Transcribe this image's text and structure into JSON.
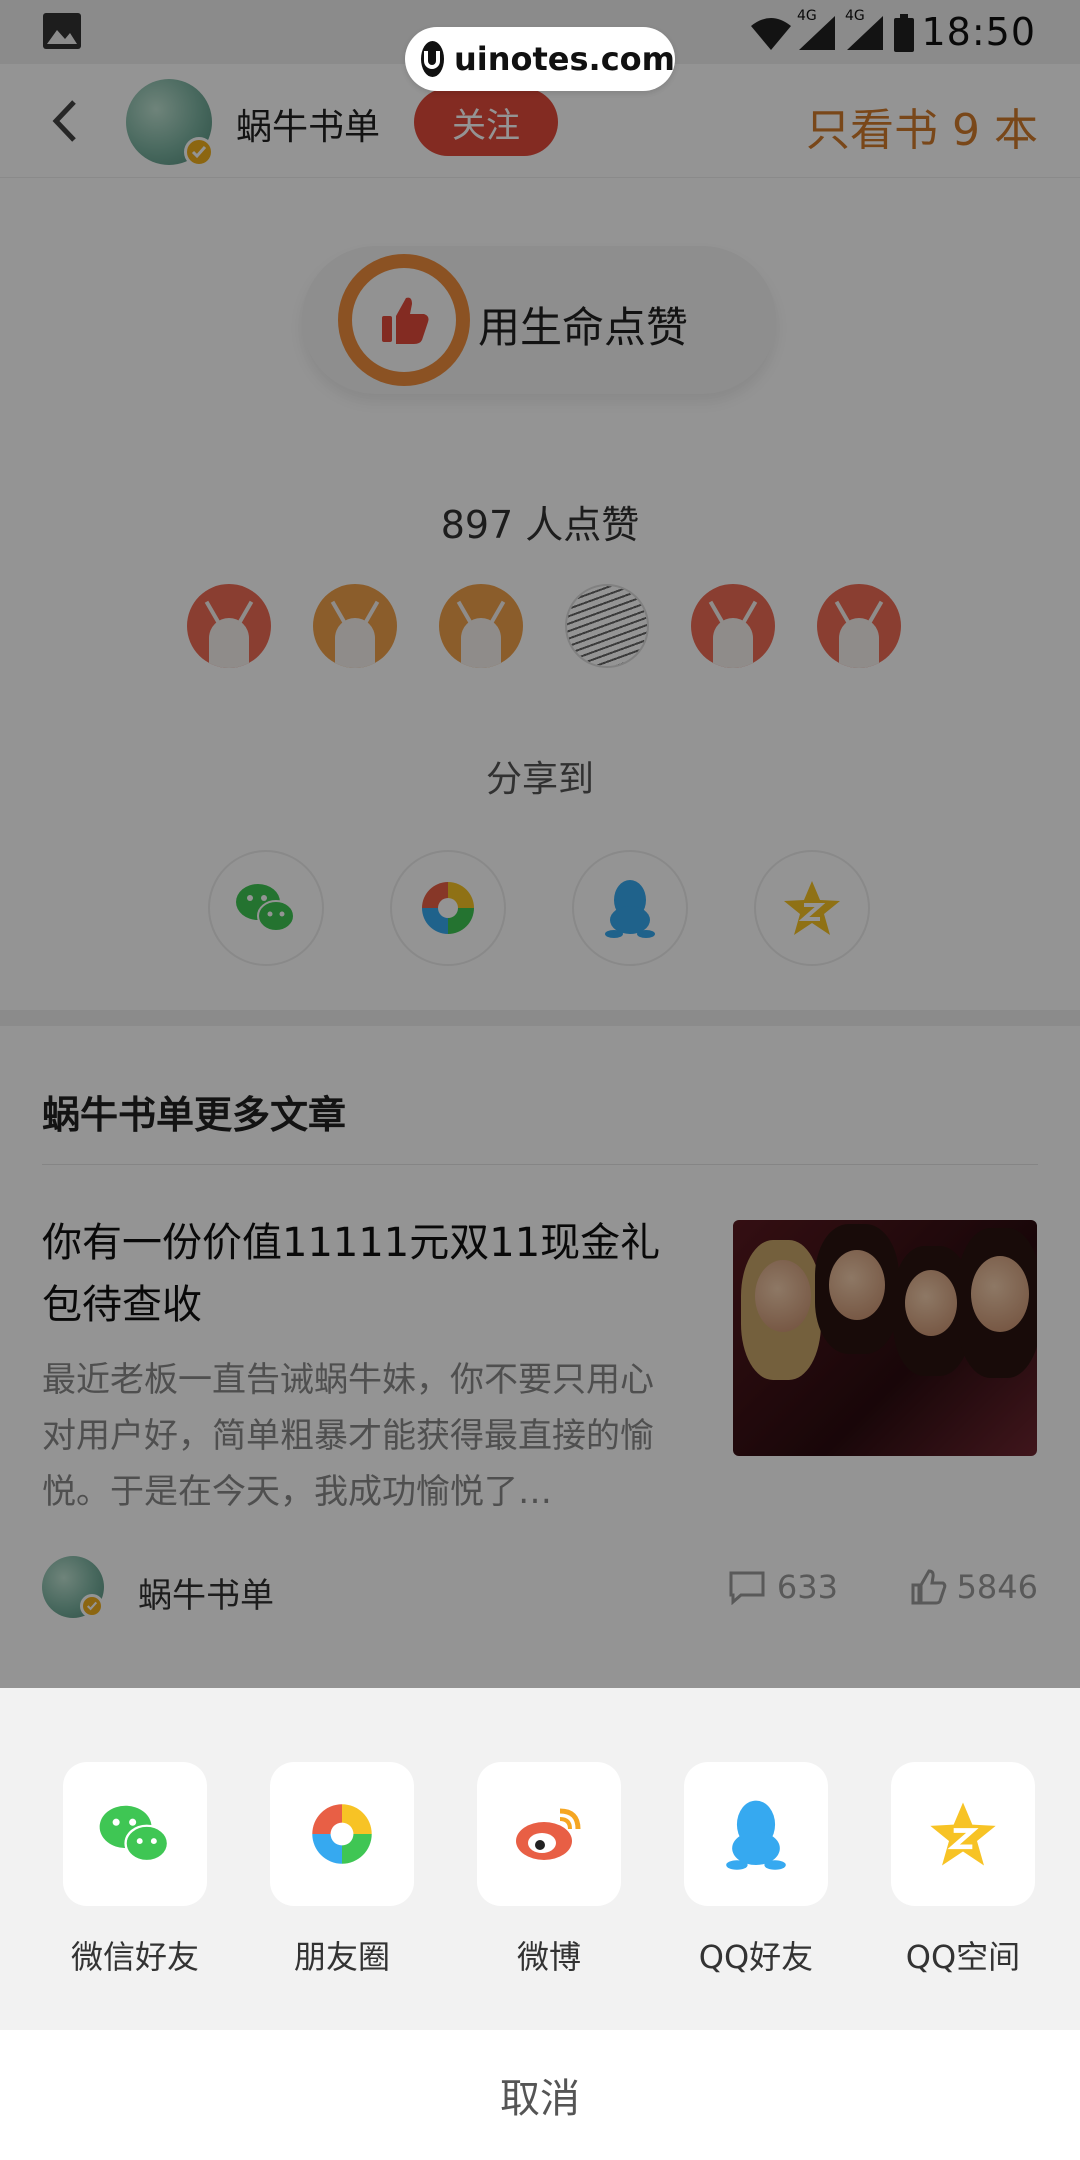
{
  "status_bar": {
    "time": "18:50",
    "network_1": "4G",
    "network_2": "4G",
    "icons": [
      "image-icon",
      "wifi-icon",
      "signal-icon",
      "signal-icon",
      "battery-icon"
    ]
  },
  "watermark": {
    "text": "uinotes.com"
  },
  "header": {
    "author": "蜗牛书单",
    "follow_label": "关注",
    "only_books": "只看书 9 本"
  },
  "like": {
    "button_label": "用生命点赞",
    "count_text": "897 人点赞"
  },
  "share": {
    "title": "分享到"
  },
  "more": {
    "title": "蜗牛书单更多文章",
    "article": {
      "title": "你有一份价值11111元双11现金礼包待查收",
      "summary": "最近老板一直告诫蜗牛妹，你不要只用心对用户好，简单粗暴才能获得最直接的愉悦。于是在今天，我成功愉悦了…",
      "author": "蜗牛书单",
      "comments": "633",
      "likes": "5846"
    }
  },
  "share_sheet": {
    "items": [
      {
        "label": "微信好友",
        "icon": "wechat-icon"
      },
      {
        "label": "朋友圈",
        "icon": "moments-icon"
      },
      {
        "label": "微博",
        "icon": "weibo-icon"
      },
      {
        "label": "QQ好友",
        "icon": "qq-icon"
      },
      {
        "label": "QQ空间",
        "icon": "qzone-icon"
      }
    ],
    "cancel_label": "取消"
  },
  "colors": {
    "follow": "#e24a3b",
    "accent_orange": "#f08e3d",
    "only_books": "#d17a2c",
    "wechat_green": "#3fc654",
    "qq_blue": "#36a9f0",
    "qzone_yellow": "#f7c325",
    "weibo_red": "#e85f45"
  }
}
